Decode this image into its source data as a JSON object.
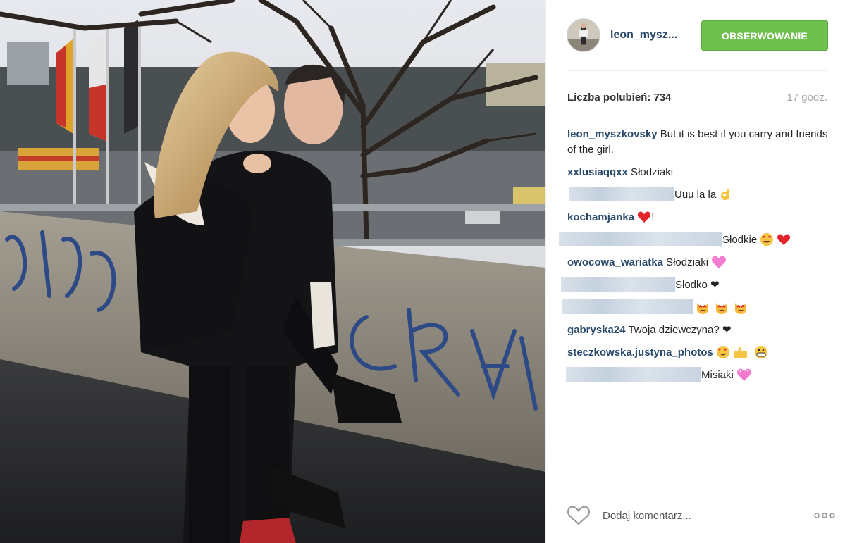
{
  "post": {
    "photo_icon": "couple-photo",
    "author": "leon_mysz...",
    "follow_label": "OBSERWOWANIE",
    "likes_label": "Liczba polubień: 734",
    "time_ago": "17 godz.",
    "caption": {
      "user": "leon_myszkovsky",
      "text": " But it is best if you carry and friends of the girl."
    },
    "comments": [
      {
        "user": "xxlusiaqqxx",
        "text": " Słodziaki",
        "redacted": false
      },
      {
        "user": "",
        "text": "Uuu la la",
        "redacted": true,
        "emoji": "ok-hand-icon"
      },
      {
        "user": "kochamjanka",
        "text": "!",
        "redacted": false,
        "emoji": "red-heart-icon"
      },
      {
        "user": "",
        "text": "Słodkie",
        "redacted": true,
        "emoji": "heart-eyes-red-heart-icon"
      },
      {
        "user": "owocowa_wariatka",
        "text": " Słodziaki",
        "redacted": false,
        "emoji": "pink-heart-icon"
      },
      {
        "user": "",
        "text": "Słodko ❤",
        "redacted": true
      },
      {
        "user": "",
        "text": "",
        "redacted": true,
        "emoji": "cat-faces-icon"
      },
      {
        "user": "gabryska24",
        "text": " Twoja dziewczyna? ❤",
        "redacted": false
      },
      {
        "user": "steczkowska.justyna_photos",
        "text": "",
        "redacted": false,
        "emoji": "heart-eyes-thumbs-up-grin-icon"
      },
      {
        "user": "",
        "text": "Misiaki",
        "redacted": true,
        "emoji": "pink-heart-icon"
      }
    ],
    "comment_placeholder": "Dodaj komentarz...",
    "like_icon": "heart-outline-icon",
    "more_icon": "more-options-icon",
    "colors": {
      "follow_green": "#70c050",
      "username_blue": "#2a4a6b",
      "time_grey": "#a5a7aa"
    }
  }
}
